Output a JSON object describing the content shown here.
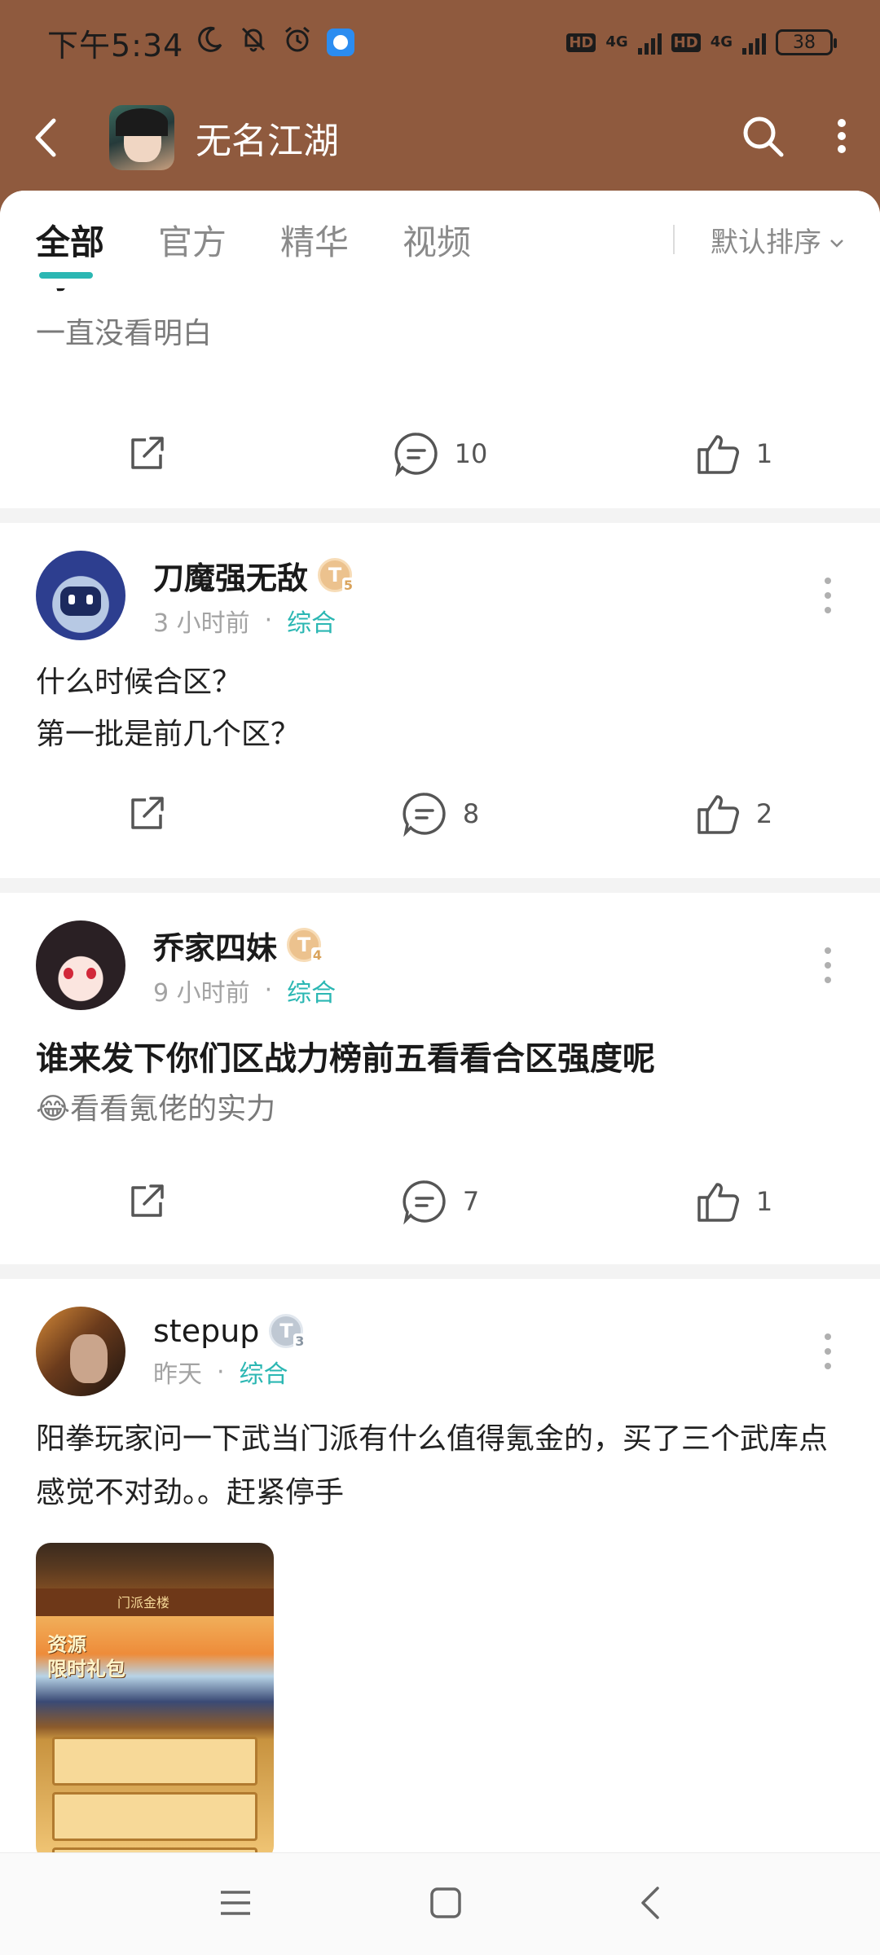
{
  "status_bar": {
    "time": "下午5:34",
    "network_1": "4G",
    "network_2": "4G",
    "hd_1": "HD",
    "hd_2": "HD",
    "battery": "38",
    "icons": [
      "moon-icon",
      "mute-icon",
      "alarm-icon",
      "app-notification-icon"
    ]
  },
  "header": {
    "title": "无名江湖",
    "icons": [
      "back-arrow-icon",
      "search-icon",
      "more-vertical-icon"
    ]
  },
  "tabs": {
    "items": [
      "全部",
      "官方",
      "精华",
      "视频"
    ],
    "active_index": 0,
    "sort_label": "默认排序"
  },
  "feed": {
    "first_post": {
      "title_fragment": "吗",
      "excerpt": "一直没看明白",
      "comments": "10",
      "likes": "1"
    },
    "posts": [
      {
        "author": "刀魔强无敌",
        "badge": "T",
        "badge_level": "5",
        "time": "3 小时前",
        "category": "综合",
        "lines": [
          "什么时候合区？",
          "第一批是前几个区？"
        ],
        "comments": "8",
        "likes": "2"
      },
      {
        "author": "乔家四妹",
        "badge": "T",
        "badge_level": "4",
        "time": "9 小时前",
        "category": "综合",
        "title": "谁来发下你们区战力榜前五看看合区强度呢",
        "excerpt": "😂看看氪佬的实力",
        "comments": "7",
        "likes": "1"
      },
      {
        "author": "stepup",
        "badge": "T",
        "badge_level": "3",
        "time": "昨天",
        "category": "综合",
        "text": "阳拳玩家问一下武当门派有什么值得氪金的，买了三个武库点感觉不对劲。。赶紧停手",
        "image": {
          "header_label": "门派金楼",
          "resource_text_1": "资源",
          "resource_text_2": "限时礼包"
        }
      }
    ]
  },
  "colors": {
    "header_bg": "#8f5a3e",
    "accent": "#2bb7b3",
    "badge_gold": "#ecc28e",
    "badge_silver": "#bfc8d3"
  },
  "nav_bar": {
    "icons": [
      "menu-icon",
      "home-square-icon",
      "back-triangle-icon"
    ]
  }
}
